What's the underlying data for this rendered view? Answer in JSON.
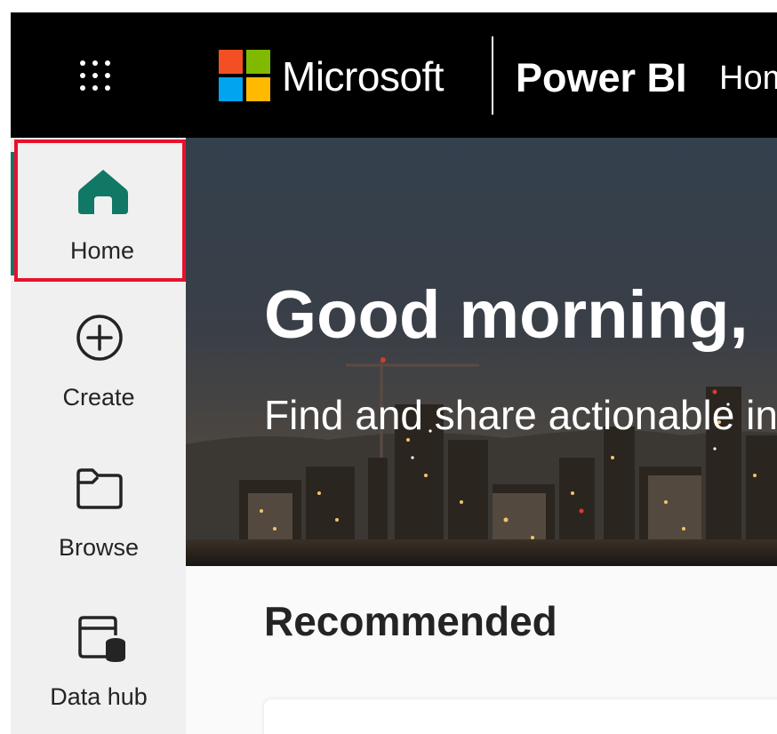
{
  "header": {
    "brand": "Microsoft",
    "product": "Power BI",
    "breadcrumb": "Home"
  },
  "nav": {
    "items": [
      {
        "label": "Home",
        "icon": "home-icon",
        "selected": true
      },
      {
        "label": "Create",
        "icon": "add-circle-icon"
      },
      {
        "label": "Browse",
        "icon": "folder-icon"
      },
      {
        "label": "Data hub",
        "icon": "data-hub-icon"
      }
    ]
  },
  "hero": {
    "greeting": "Good morning,",
    "subtitle": "Find and share actionable insights"
  },
  "main": {
    "section_title": "Recommended"
  },
  "colors": {
    "topbar": "#000000",
    "nav_background": "#f0f0f0",
    "accent": "#117865",
    "selection_outline": "#e8112d",
    "ms_red": "#f25022",
    "ms_green": "#7fba00",
    "ms_blue": "#00a4ef",
    "ms_yellow": "#ffb900"
  }
}
